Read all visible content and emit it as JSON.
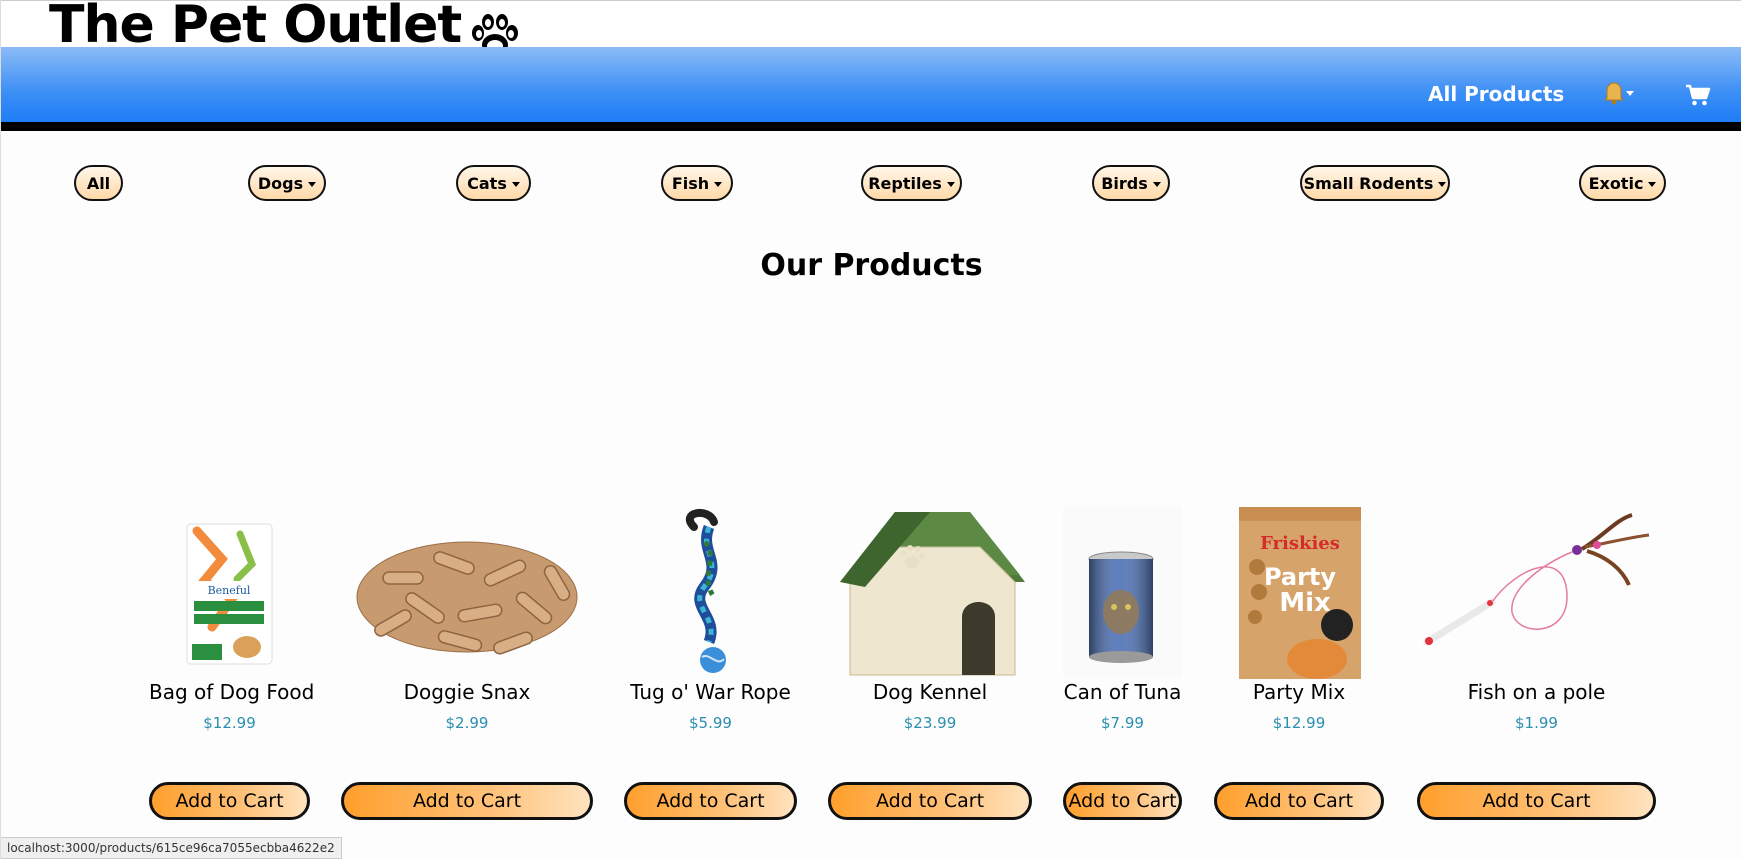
{
  "header": {
    "brand_title": "The Pet Outlet",
    "brand_icon": "paw-icon"
  },
  "navbar": {
    "all_products_label": "All Products",
    "notifications_icon": "bell-icon",
    "cart_icon": "cart-icon"
  },
  "categories": [
    {
      "label": "All",
      "has_dropdown": false
    },
    {
      "label": "Dogs",
      "has_dropdown": true
    },
    {
      "label": "Cats",
      "has_dropdown": true
    },
    {
      "label": "Fish",
      "has_dropdown": true
    },
    {
      "label": "Reptiles",
      "has_dropdown": true
    },
    {
      "label": "Birds",
      "has_dropdown": true
    },
    {
      "label": "Small Rodents",
      "has_dropdown": true
    },
    {
      "label": "Exotic",
      "has_dropdown": true
    }
  ],
  "main": {
    "heading": "Our Products",
    "add_to_cart_label": "Add to Cart"
  },
  "products": [
    {
      "name": "Bag of Dog Food",
      "price": "$12.99"
    },
    {
      "name": "Doggie Snax",
      "price": "$2.99"
    },
    {
      "name": "Tug o' War Rope",
      "price": "$5.99"
    },
    {
      "name": "Dog Kennel",
      "price": "$23.99"
    },
    {
      "name": "Can of Tuna",
      "price": "$7.99"
    },
    {
      "name": "Party Mix",
      "price": "$12.99"
    },
    {
      "name": "Fish on a pole",
      "price": "$1.99"
    }
  ],
  "status_bar": {
    "url": "localhost:3000/products/615ce96ca7055ecbba4622e2"
  },
  "colors": {
    "navbar_blue": "#1f7df6",
    "price_teal": "#2a8fb0",
    "button_orange": "#ff9f2c",
    "category_pill": "#ffd9a8"
  }
}
